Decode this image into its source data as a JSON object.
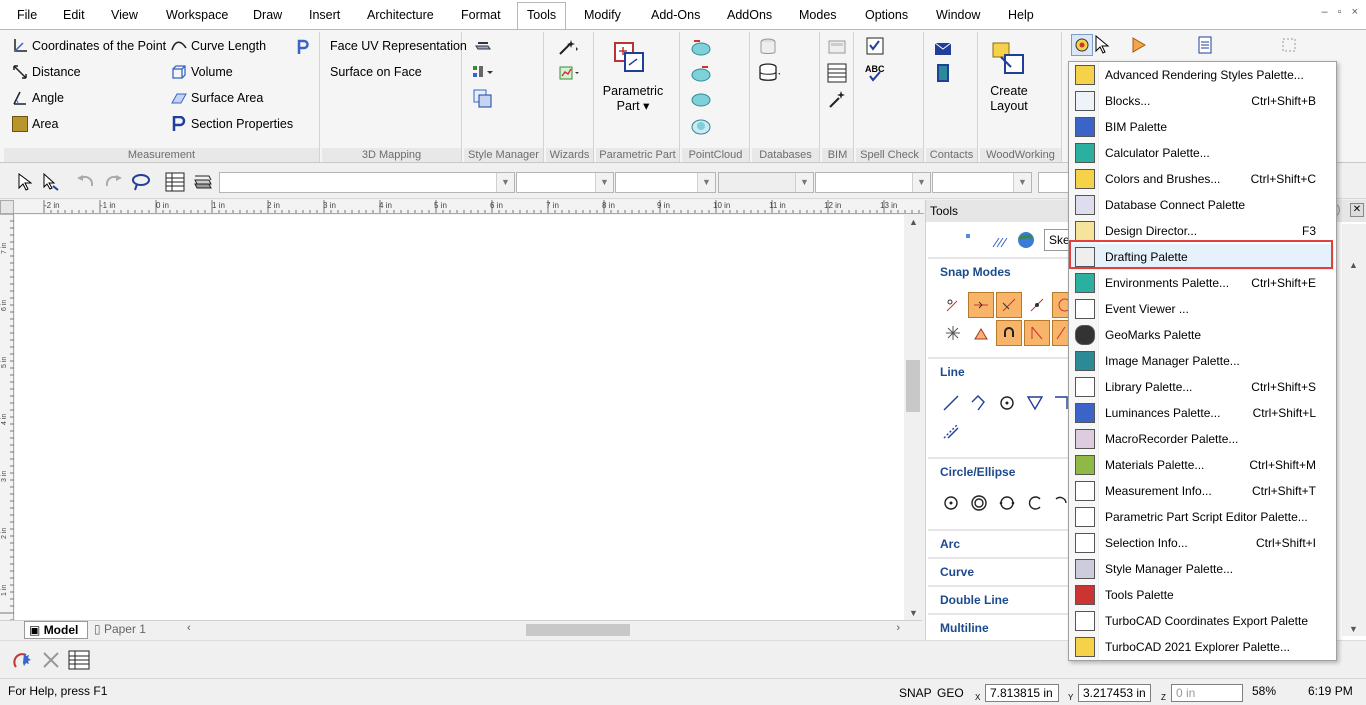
{
  "menu": [
    "File",
    "Edit",
    "View",
    "Workspace",
    "Draw",
    "Insert",
    "Architecture",
    "Format",
    "Tools",
    "Modify",
    "Add-Ons",
    "AddOns",
    "Modes",
    "Options",
    "Window",
    "Help"
  ],
  "window_controls": [
    "–",
    "▫",
    "×"
  ],
  "ribbon": {
    "measurement": {
      "items": [
        "Coordinates of the Point",
        "Distance",
        "Angle",
        "Area",
        "Curve Length",
        "Volume",
        "Surface Area",
        "Section Properties"
      ],
      "label": "Measurement"
    },
    "mapping": {
      "items": [
        "Face UV Representation",
        "Surface on Face"
      ],
      "label": "3D Mapping"
    },
    "style_manager": {
      "label": "Style Manager"
    },
    "wizards": {
      "label": "Wizards"
    },
    "parametric_part": {
      "button": "Parametric Part",
      "label": "Parametric Part"
    },
    "pointcloud": {
      "label": "PointCloud"
    },
    "databases": {
      "label": "Databases"
    },
    "bim": {
      "label": "BIM"
    },
    "spell_check": {
      "label": "Spell Check",
      "abc": "ABC"
    },
    "contacts": {
      "label": "Contacts"
    },
    "woodworking": {
      "button": "Create Layout",
      "label": "WoodWorking"
    }
  },
  "tools_panel": {
    "title": "Tools",
    "search_value": "Ske",
    "sections": [
      "Snap Modes",
      "Line",
      "Circle/Ellipse",
      "Arc",
      "Curve",
      "Double Line",
      "Multiline"
    ]
  },
  "tabs": [
    "Model",
    "Paper 1"
  ],
  "status": {
    "help": "For Help, press F1",
    "snap": "SNAP",
    "geo": "GEO",
    "x_label": "X",
    "x": "7.813815 in",
    "y_label": "Y",
    "y": "3.217453 in",
    "z_label": "Z",
    "z": "0 in",
    "zoom": "58%",
    "time": "6:19 PM"
  },
  "ruler": {
    "h": [
      "-2 in",
      "-1 in",
      "0 in",
      "1 in",
      "2 in",
      "3 in",
      "4 in",
      "5 in",
      "6 in",
      "7 in",
      "8 in",
      "9 in",
      "10 in",
      "11 in",
      "12 in",
      "13 in"
    ],
    "v": [
      "7 in",
      "6 in",
      "5 in",
      "4 in",
      "3 in",
      "2 in",
      "1 in"
    ]
  },
  "dropdown": [
    {
      "label": "Advanced Rendering Styles Palette...",
      "shortcut": ""
    },
    {
      "label": "Blocks...",
      "shortcut": "Ctrl+Shift+B"
    },
    {
      "label": "BIM Palette",
      "shortcut": ""
    },
    {
      "label": "Calculator Palette...",
      "shortcut": ""
    },
    {
      "label": "Colors and Brushes...",
      "shortcut": "Ctrl+Shift+C"
    },
    {
      "label": "Database Connect Palette",
      "shortcut": ""
    },
    {
      "label": "Design Director...",
      "shortcut": "F3"
    },
    {
      "label": "Drafting Palette",
      "shortcut": ""
    },
    {
      "label": "Environments Palette...",
      "shortcut": "Ctrl+Shift+E"
    },
    {
      "label": "Event Viewer ...",
      "shortcut": ""
    },
    {
      "label": "GeoMarks Palette",
      "shortcut": ""
    },
    {
      "label": "Image Manager Palette...",
      "shortcut": ""
    },
    {
      "label": "Library Palette...",
      "shortcut": "Ctrl+Shift+S"
    },
    {
      "label": "Luminances Palette...",
      "shortcut": "Ctrl+Shift+L"
    },
    {
      "label": "MacroRecorder Palette...",
      "shortcut": ""
    },
    {
      "label": "Materials Palette...",
      "shortcut": "Ctrl+Shift+M"
    },
    {
      "label": "Measurement Info...",
      "shortcut": "Ctrl+Shift+T"
    },
    {
      "label": "Parametric Part Script Editor Palette...",
      "shortcut": ""
    },
    {
      "label": "Selection Info...",
      "shortcut": "Ctrl+Shift+I"
    },
    {
      "label": "Style Manager Palette...",
      "shortcut": ""
    },
    {
      "label": "Tools Palette",
      "shortcut": ""
    },
    {
      "label": "TurboCAD Coordinates Export Palette",
      "shortcut": ""
    },
    {
      "label": "TurboCAD 2021 Explorer Palette...",
      "shortcut": ""
    }
  ],
  "colors": {
    "accent": "#1c4a8c",
    "highlight_border": "#e0413f",
    "snap_active": "#f8b468"
  }
}
